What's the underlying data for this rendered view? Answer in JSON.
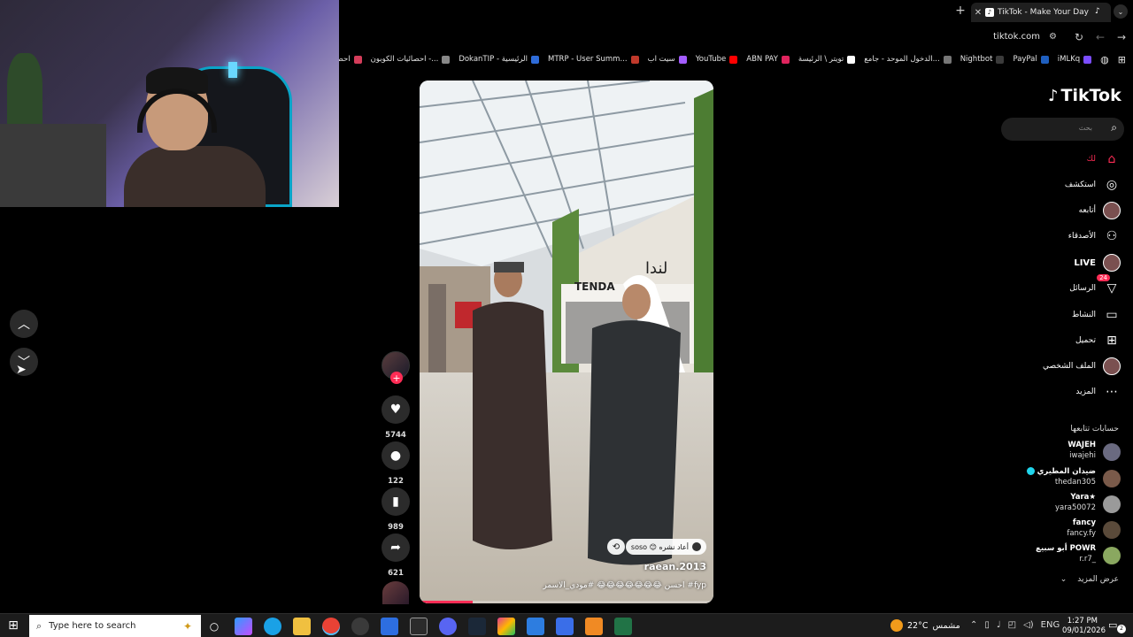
{
  "browser": {
    "tab_title": "TikTok - Make Your Day",
    "url": "tiktok.com",
    "bookmarks": [
      {
        "label": "iMLKq",
        "color": "#7b4dff"
      },
      {
        "label": "PayPal",
        "color": "#1f5fbf"
      },
      {
        "label": "Nightbot",
        "color": "#3b3b3b"
      },
      {
        "label": "الدخول الموحد - جامع...",
        "color": "#777777"
      },
      {
        "label": "تويتر \\ الرئيسة",
        "color": "#ffffff"
      },
      {
        "label": "ABN PAY",
        "color": "#e0245e"
      },
      {
        "label": "YouTube",
        "color": "#ff0000"
      },
      {
        "label": "سيت اب",
        "color": "#a35cff"
      },
      {
        "label": "MTRP - User Summ...",
        "color": "#c0392b"
      },
      {
        "label": "DokanTIP - الرئيسية",
        "color": "#2e6bd8"
      },
      {
        "label": "احصائيات الكوبون -...",
        "color": "#888888"
      },
      {
        "label": "احصائيات",
        "color": "#d43d5a"
      }
    ]
  },
  "tiktok": {
    "logo_text": "TikTok",
    "search_placeholder": "بحث",
    "nav": [
      {
        "label": "لك",
        "icon": "home-icon",
        "glyph": "⌂",
        "active": true
      },
      {
        "label": "استكشف",
        "icon": "compass-icon",
        "glyph": "◎"
      },
      {
        "label": "أتابعه",
        "icon": "avatar-icon",
        "glyph": "",
        "avatar": true
      },
      {
        "label": "الأصدقاء",
        "icon": "friends-icon",
        "glyph": "⚇"
      },
      {
        "label": "LIVE",
        "icon": "live-icon",
        "glyph": "",
        "avatar": true,
        "live": true
      },
      {
        "label": "الرسائل",
        "icon": "inbox-icon",
        "glyph": "▽",
        "badge": "24"
      },
      {
        "label": "النشاط",
        "icon": "activity-icon",
        "glyph": "▭"
      },
      {
        "label": "تحميل",
        "icon": "upload-icon",
        "glyph": "⊞"
      },
      {
        "label": "الملف الشخصي",
        "icon": "profile-icon",
        "glyph": "",
        "avatar": true
      },
      {
        "label": "المزيد",
        "icon": "more-icon",
        "glyph": "⋯"
      }
    ],
    "following_title": "حسابات تتابعها",
    "following": [
      {
        "name": "WAJEH",
        "handle": "iwajehi",
        "verified": false,
        "color": "#6a6a80"
      },
      {
        "name": "ضيدان المطيري",
        "handle": "thedan305",
        "verified": true,
        "color": "#7a5a4a"
      },
      {
        "name": "Yara★",
        "handle": "yara50072",
        "verified": false,
        "color": "#9a9a9a"
      },
      {
        "name": "fancy",
        "handle": "fancy.fy",
        "verified": false,
        "color": "#5a4a3a"
      },
      {
        "name": "أبو سبيع POWR",
        "handle": "r.r7_",
        "verified": false,
        "color": "#8aa860"
      }
    ],
    "see_more": "عرض المزيد"
  },
  "video": {
    "author": "raean.2013",
    "caption": "احسن 😂😂😂😂😂😂😂 #مودي_الاسمر #fyp",
    "repost_text": "soso 😊 أعاد نشره",
    "progress": 0.18,
    "likes": "5744",
    "comments": "122",
    "saves": "989",
    "shares": "621"
  },
  "taskbar": {
    "search_placeholder": "Type here to search",
    "weather_temp": "22°C",
    "weather_text": "مشمس",
    "lang": "ENG",
    "time": "1:27 PM",
    "date": "09/01/2026",
    "notification_count": "2"
  }
}
